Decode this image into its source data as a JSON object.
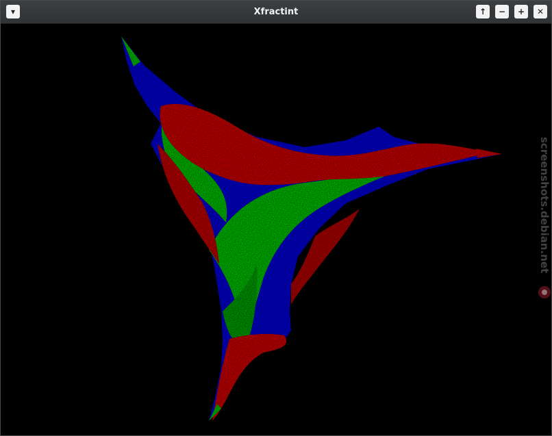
{
  "window": {
    "title": "Xfractint",
    "buttons": {
      "menu": "▾",
      "raise": "↑",
      "minimize": "−",
      "maximize": "+",
      "close": "✕"
    }
  },
  "fractal": {
    "colors": {
      "background": "#000000",
      "red": "#d01818",
      "green": "#18c818",
      "blue": "#1020e0"
    }
  },
  "watermark": {
    "text": "screenshots.debian.net"
  }
}
